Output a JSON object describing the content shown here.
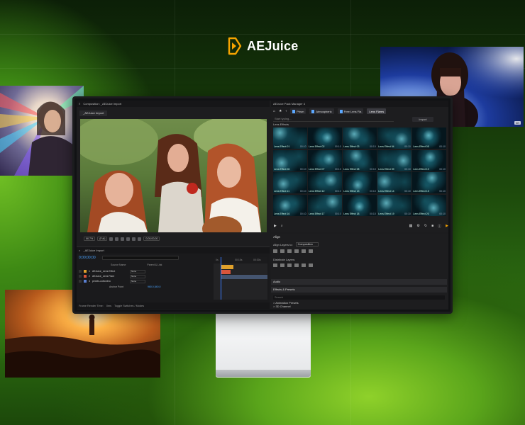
{
  "brand": {
    "name": "AEJuice",
    "accent": "#f5a300"
  },
  "photo_badge": "4K",
  "comp_panel": {
    "tab": "Composition: _AEJuice Import",
    "sub_tab": "_AEJuice Import",
    "zoom": "66.7%",
    "resolution": "(Full)",
    "timecode_toolbar": "0;00;00;00"
  },
  "timeline": {
    "tab": "_AEJuice Import",
    "time": "0;00;00;00",
    "columns": [
      "Source Name",
      "Parent & Link"
    ],
    "layers": [
      {
        "num": "1",
        "name": "AEJuice_Lens Effect",
        "mode": "None",
        "color": "#e0a12b"
      },
      {
        "num": "2",
        "name": "AEJuice_Lens Flare",
        "mode": "None",
        "color": "#d9553a"
      },
      {
        "num": "3",
        "name": "pexels-cottonbro",
        "mode": "None",
        "color": "#5a7fd1"
      }
    ],
    "anchor_label": "Anchor Point",
    "anchor_value": "960.0,540.0",
    "ruler": [
      "0s",
      "00:15s",
      "00:30s"
    ],
    "status_left": "Frame Render Time:",
    "status_time": "0ms",
    "status_right": "Toggle Switches / Modes"
  },
  "pack_manager": {
    "tab": "AEJuice Pack Manager 4",
    "breadcrumbs": [
      "Prism",
      "Atmospheric",
      "Free Lens Fla",
      "Lens Flares"
    ],
    "search_placeholder": "Start typing...",
    "import_label": "Import",
    "folder": "Lens Effects",
    "items": [
      {
        "label": "Lens Effect 01",
        "dur": "00:10"
      },
      {
        "label": "Lens Effect 02",
        "dur": "00:10"
      },
      {
        "label": "Lens Effect 03",
        "dur": "00:10"
      },
      {
        "label": "Lens Effect 04",
        "dur": "00:10"
      },
      {
        "label": "Lens Effect 05",
        "dur": "00:10"
      },
      {
        "label": "Lens Effect 06",
        "dur": "00:10"
      },
      {
        "label": "Lens Effect 07",
        "dur": "00:10"
      },
      {
        "label": "Lens Effect 08",
        "dur": "00:10"
      },
      {
        "label": "Lens Effect 09",
        "dur": "00:10"
      },
      {
        "label": "Lens Effect 10",
        "dur": "00:10"
      },
      {
        "label": "Lens Effect 11",
        "dur": "00:10"
      },
      {
        "label": "Lens Effect 12",
        "dur": "00:10"
      },
      {
        "label": "Lens Effect 13",
        "dur": "00:10"
      },
      {
        "label": "Lens Effect 14",
        "dur": "00:10"
      },
      {
        "label": "Lens Effect 15",
        "dur": "00:10"
      },
      {
        "label": "Lens Effect 16",
        "dur": "00:10"
      },
      {
        "label": "Lens Effect 17",
        "dur": "00:10"
      },
      {
        "label": "Lens Effect 18",
        "dur": "00:10"
      },
      {
        "label": "Lens Effect 19",
        "dur": "00:10"
      },
      {
        "label": "Lens Effect 20",
        "dur": "00:10"
      }
    ]
  },
  "align_panel": {
    "title": "Align",
    "align_to_label": "Align Layers to:",
    "align_to_value": "Composition",
    "distribute_label": "Distribute Layers:",
    "audio": "Audio",
    "effects_title": "Effects & Presets",
    "effects_search": "Search",
    "effects_list": [
      "> Animation Presets",
      "> 3D Channel"
    ]
  }
}
